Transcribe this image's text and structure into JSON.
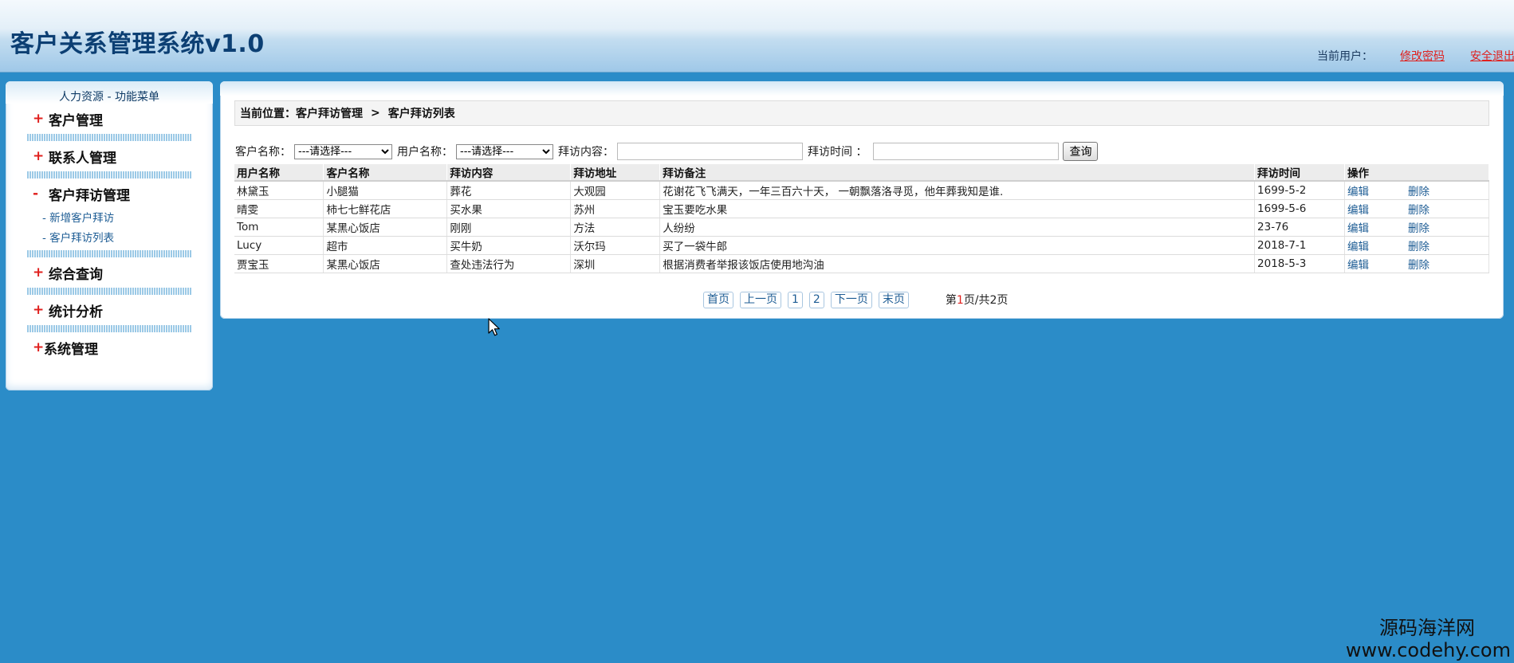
{
  "header": {
    "title": "客户关系管理系统v1.0",
    "current_user_label": "当前用户：",
    "change_password": "修改密码",
    "logout": "安全退出"
  },
  "sidebar": {
    "top_label": "人力资源  - 功能菜单",
    "groups": [
      {
        "sign": "+",
        "label": "客户管理"
      },
      {
        "sign": "+",
        "label": "联系人管理"
      },
      {
        "sign": "-",
        "label": "客户拜访管理",
        "items": [
          "- 新增客户拜访",
          "- 客户拜访列表"
        ]
      },
      {
        "sign": "+",
        "label": "综合查询"
      },
      {
        "sign": "+",
        "label": "统计分析"
      },
      {
        "sign": "+",
        "label": "系统管理"
      }
    ]
  },
  "breadcrumb": {
    "prefix": "当前位置：",
    "level1": "客户拜访管理",
    "separator": ">",
    "level2": "客户拜访列表"
  },
  "search": {
    "customer_label": "客户名称：",
    "customer_selected": "---请选择---",
    "user_label": "用户名称：",
    "user_selected": "---请选择---",
    "content_label": "拜访内容：",
    "content_value": "",
    "time_label": "拜访时间 ：",
    "time_value": "",
    "button": "查询"
  },
  "table": {
    "columns": [
      "用户名称",
      "客户名称",
      "拜访内容",
      "拜访地址",
      "拜访备注",
      "拜访时间",
      "操作"
    ],
    "edit_label": "编辑",
    "delete_label": "删除",
    "rows": [
      {
        "user": "林黛玉",
        "customer": "小腿猫",
        "content": "葬花",
        "address": "大观园",
        "note": "花谢花飞飞满天，一年三百六十天， 一朝飘落洛寻觅，他年葬我知是谁.",
        "time": "1699-5-2"
      },
      {
        "user": "晴雯",
        "customer": "柿七七鲜花店",
        "content": "买水果",
        "address": "苏州",
        "note": "宝玉要吃水果",
        "time": "1699-5-6"
      },
      {
        "user": "Tom",
        "customer": "某黑心饭店",
        "content": "刚刚",
        "address": "方法",
        "note": "人纷纷",
        "time": "23-76"
      },
      {
        "user": "Lucy",
        "customer": "超市",
        "content": "买牛奶",
        "address": "沃尔玛",
        "note": "买了一袋牛郎",
        "time": "2018-7-1"
      },
      {
        "user": "贾宝玉",
        "customer": "某黑心饭店",
        "content": "查处违法行为",
        "address": "深圳",
        "note": "根据消费者举报该饭店使用地沟油",
        "time": "2018-5-3"
      }
    ]
  },
  "pagination": {
    "first": "首页",
    "prev": "上一页",
    "pages": [
      "1",
      "2"
    ],
    "next": "下一页",
    "last": "末页",
    "info_prefix": "第",
    "current_page": "1",
    "info_middle": "页/共",
    "total_pages": "2",
    "info_suffix": "页"
  },
  "watermark": {
    "line1": "源码海洋网",
    "line2": "www.codehy.com"
  },
  "colors": {
    "background": "#2b8cc8",
    "accent_red": "#e0201e",
    "link_blue": "#1d5c94",
    "title_blue": "#0c3f73"
  },
  "icons": {
    "cursor": "mouse-pointer-icon"
  }
}
